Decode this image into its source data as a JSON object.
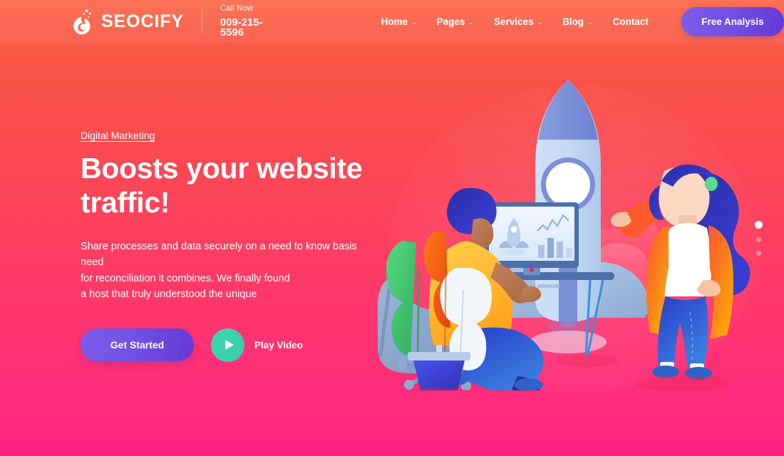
{
  "brand": {
    "name": "SEOCIFY",
    "logo_icon": "water-drop-bubbles-icon"
  },
  "header": {
    "call": {
      "label": "Call Now",
      "number": "009-215-5596"
    },
    "nav": [
      {
        "label": "Home",
        "has_dropdown": true,
        "caret": "⌄"
      },
      {
        "label": "Pages",
        "has_dropdown": true,
        "caret": "⌄"
      },
      {
        "label": "Services",
        "has_dropdown": true,
        "caret": "⌄"
      },
      {
        "label": "Blog",
        "has_dropdown": true,
        "caret": "⌄"
      },
      {
        "label": "Contact",
        "has_dropdown": false,
        "caret": ""
      }
    ],
    "cta_button": "Free Analysis"
  },
  "hero": {
    "eyebrow": "Digital Marketing",
    "title_line1": "Boosts your website",
    "title_line2": "traffic!",
    "desc_line1": "Share processes and data securely on a need to know basis need",
    "desc_line2": "for reconciliation it combines. We finally found",
    "desc_line3": "a host that truly understood the unique",
    "primary_button": "Get Started",
    "play_button_label": "Play Video",
    "play_icon": "play-triangle-icon"
  },
  "slider": {
    "dots": [
      {
        "active": true
      },
      {
        "active": false
      },
      {
        "active": false
      }
    ]
  },
  "illustration": {
    "alt": "seo-team-rocket-illustration",
    "elements": [
      "rocket",
      "monitor",
      "seated-man",
      "standing-woman",
      "office-chair",
      "desk",
      "potted-plant",
      "clouds"
    ]
  },
  "colors": {
    "bg_top": "#fb6a4d",
    "bg_bottom": "#ff2382",
    "accent_purple": "#7253e4",
    "accent_purple_dark": "#6639d6",
    "play_teal": "#3ccfb0",
    "text_white": "#ffffff"
  }
}
